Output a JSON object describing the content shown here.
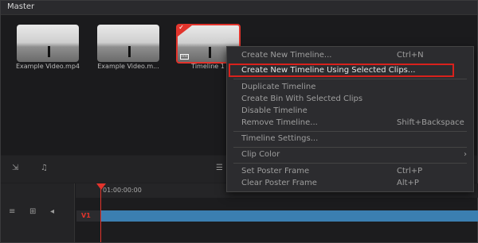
{
  "header": {
    "title": "Master"
  },
  "clips": [
    {
      "label": "Example Video.mp4"
    },
    {
      "label": "Example Video.m..."
    },
    {
      "label": "Timeline 1"
    }
  ],
  "context_menu": {
    "items": [
      {
        "label": "Create New Timeline...",
        "shortcut": "Ctrl+N"
      },
      {
        "label": "Create New Timeline Using Selected Clips..."
      },
      {
        "label": "Duplicate Timeline"
      },
      {
        "label": "Create Bin With Selected Clips"
      },
      {
        "label": "Disable Timeline"
      },
      {
        "label": "Remove Timeline...",
        "shortcut": "Shift+Backspace"
      },
      {
        "label": "Timeline Settings..."
      },
      {
        "label": "Clip Color"
      },
      {
        "label": "Set Poster Frame",
        "shortcut": "Ctrl+P"
      },
      {
        "label": "Clear Poster Frame",
        "shortcut": "Alt+P"
      }
    ]
  },
  "timeline": {
    "timecode": "01:00:00:00",
    "track": "V1"
  },
  "colors": {
    "selection": "#e2342c",
    "clip": "#3b7fb1"
  }
}
